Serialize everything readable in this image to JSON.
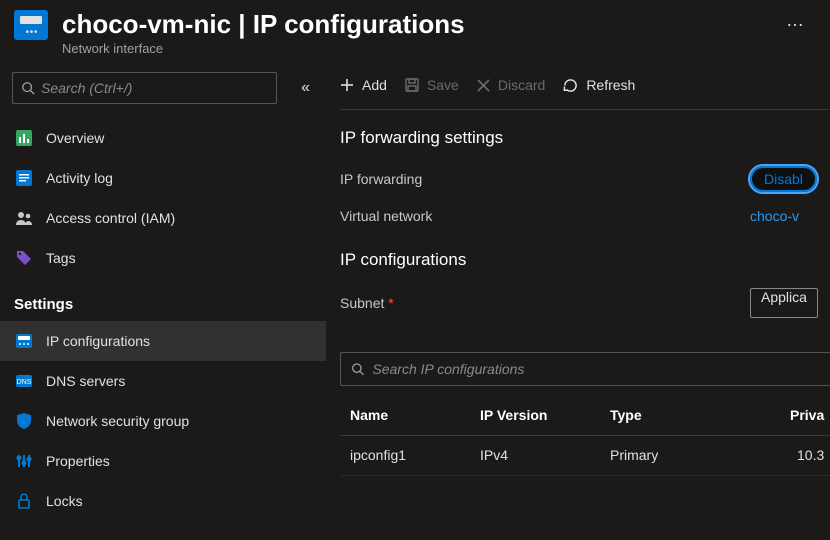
{
  "header": {
    "title": "choco-vm-nic | IP configurations",
    "subtitle": "Network interface"
  },
  "sidebar": {
    "search_placeholder": "Search (Ctrl+/)",
    "section_label": "Settings",
    "items": [
      {
        "label": "Overview",
        "icon": "overview-icon",
        "selected": false
      },
      {
        "label": "Activity log",
        "icon": "log-icon",
        "selected": false
      },
      {
        "label": "Access control (IAM)",
        "icon": "people-icon",
        "selected": false
      },
      {
        "label": "Tags",
        "icon": "tag-icon",
        "selected": false
      }
    ],
    "settings_items": [
      {
        "label": "IP configurations",
        "icon": "ipconfig-icon",
        "selected": true
      },
      {
        "label": "DNS servers",
        "icon": "dns-icon",
        "selected": false
      },
      {
        "label": "Network security group",
        "icon": "shield-icon",
        "selected": false
      },
      {
        "label": "Properties",
        "icon": "properties-icon",
        "selected": false
      },
      {
        "label": "Locks",
        "icon": "lock-icon",
        "selected": false
      }
    ]
  },
  "toolbar": {
    "add": "Add",
    "save": "Save",
    "discard": "Discard",
    "refresh": "Refresh"
  },
  "forwarding": {
    "heading": "IP forwarding settings",
    "label": "IP forwarding",
    "toggle_value": "Disabl",
    "vnet_label": "Virtual network",
    "vnet_value": "choco-v"
  },
  "ipconfig": {
    "heading": "IP configurations",
    "subnet_label": "Subnet",
    "subnet_value": "Applica",
    "search_placeholder": "Search IP configurations"
  },
  "table": {
    "columns": {
      "name": "Name",
      "version": "IP Version",
      "type": "Type",
      "private": "Priva"
    },
    "rows": [
      {
        "name": "ipconfig1",
        "version": "IPv4",
        "type": "Primary",
        "private": "10.3"
      }
    ]
  }
}
